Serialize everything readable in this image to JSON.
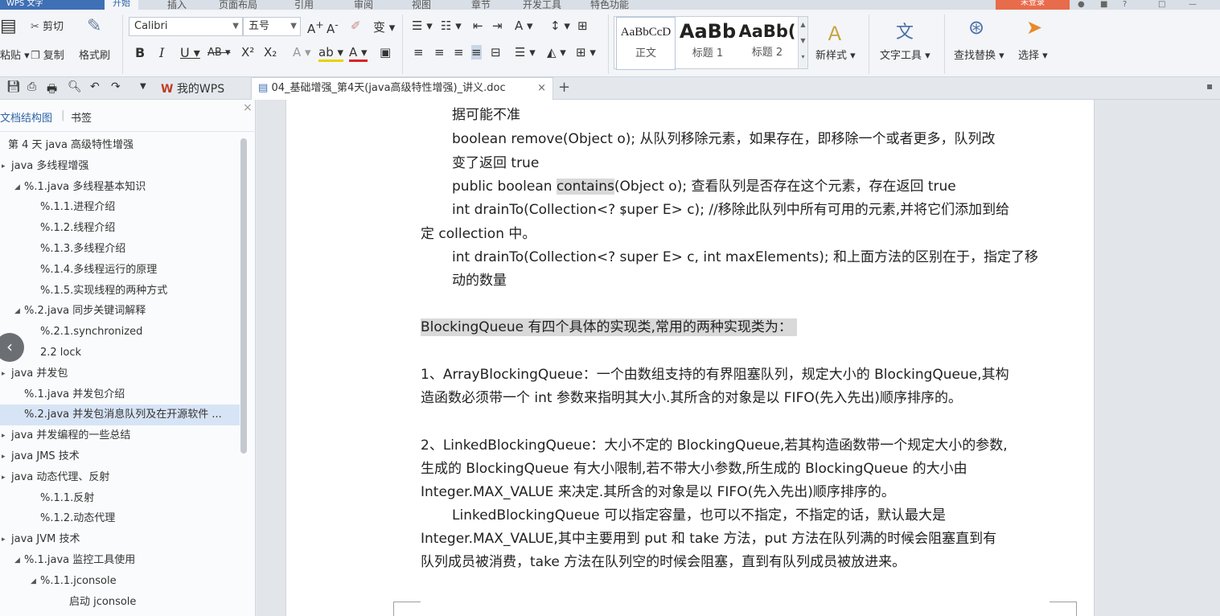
{
  "menubar": {
    "brand": "WPS 文字",
    "items": [
      "开始",
      "插入",
      "页面布局",
      "引用",
      "审阅",
      "视图",
      "章节",
      "开发工具",
      "特色功能"
    ],
    "login": "未登录"
  },
  "ribbon": {
    "paste": "粘贴",
    "cut": "剪切",
    "copy": "复制",
    "format_painter": "格式刷",
    "font_name": "Calibri",
    "font_size": "五号",
    "styles": [
      {
        "sample": "AaBbCcD",
        "label": "正文"
      },
      {
        "sample": "AaBb",
        "label": "标题 1"
      },
      {
        "sample": "AaBb(",
        "label": "标题 2"
      }
    ],
    "new_style": "新样式",
    "text_tools": "文字工具",
    "find_replace": "查找替换",
    "select": "选择"
  },
  "quickbar": {
    "my_wps": "我的WPS",
    "doc_tab_title": "04_基础增强_第4天(java高级特性增强)_讲义.doc"
  },
  "nav": {
    "tab_outline": "文档结构图",
    "tab_bookmark": "书签",
    "items": [
      {
        "text": "第 4 天 java 高级特性增强",
        "indent": 10,
        "arrow": ""
      },
      {
        "text": "java 多线程增强",
        "indent": 14,
        "arrow": "▸"
      },
      {
        "text": "%.1.java 多线程基本知识",
        "indent": 30,
        "arrow": "◢"
      },
      {
        "text": "%.1.1.进程介绍",
        "indent": 50,
        "arrow": ""
      },
      {
        "text": "%.1.2.线程介绍",
        "indent": 50,
        "arrow": ""
      },
      {
        "text": "%.1.3.多线程介绍",
        "indent": 50,
        "arrow": ""
      },
      {
        "text": "%.1.4.多线程运行的原理",
        "indent": 50,
        "arrow": ""
      },
      {
        "text": "%.1.5.实现线程的两种方式",
        "indent": 50,
        "arrow": ""
      },
      {
        "text": "%.2.java 同步关键词解释",
        "indent": 30,
        "arrow": "◢"
      },
      {
        "text": "%.2.1.synchronized",
        "indent": 50,
        "arrow": ""
      },
      {
        "text": "2.2 lock",
        "indent": 50,
        "arrow": ""
      },
      {
        "text": "java 并发包",
        "indent": 14,
        "arrow": "▸"
      },
      {
        "text": "%.1.java 并发包介绍",
        "indent": 30,
        "arrow": ""
      },
      {
        "text": "%.2.java 并发包消息队列及在开源软件 ...",
        "indent": 30,
        "arrow": "",
        "selected": true
      },
      {
        "text": "java 并发编程的一些总结",
        "indent": 14,
        "arrow": "▸"
      },
      {
        "text": "java JMS 技术",
        "indent": 14,
        "arrow": "▸"
      },
      {
        "text": "java 动态代理、反射",
        "indent": 14,
        "arrow": "▸"
      },
      {
        "text": "%.1.1.反射",
        "indent": 50,
        "arrow": ""
      },
      {
        "text": "%.1.2.动态代理",
        "indent": 50,
        "arrow": ""
      },
      {
        "text": "java JVM 技术",
        "indent": 14,
        "arrow": "▸"
      },
      {
        "text": "%.1.java 监控工具使用",
        "indent": 30,
        "arrow": "◢"
      },
      {
        "text": "%.1.1.jconsole",
        "indent": 50,
        "arrow": "◢"
      },
      {
        "text": "启动 jconsole",
        "indent": 86,
        "arrow": ""
      }
    ]
  },
  "doc": {
    "l1": "据可能不准",
    "l2": "boolean remove(Object o); 从队列移除元素，如果存在，即移除一个或者更多，队列改",
    "l3": "变了返回 true",
    "l4a": "public boolean ",
    "l4b": "contains",
    "l4c": "(Object o); 查看队列是否存在这个元素，存在返回 true",
    "l5": "int drainTo(Collection<? super E> c); //移除此队列中所有可用的元素,并将它们添加到给",
    "l6": "定 collection 中。",
    "l7": "int drainTo(Collection<? super E> c, int maxElements); 和上面方法的区别在于，指定了移",
    "l8": "动的数量",
    "l9": "BlockingQueue 有四个具体的实现类,常用的两种实现类为：",
    "l10": "1、ArrayBlockingQueue：一个由数组支持的有界阻塞队列，规定大小的 BlockingQueue,其构",
    "l11": "造函数必须带一个 int 参数来指明其大小.其所含的对象是以 FIFO(先入先出)顺序排序的。",
    "l12": "2、LinkedBlockingQueue：大小不定的 BlockingQueue,若其构造函数带一个规定大小的参数,",
    "l13": "生成的 BlockingQueue 有大小限制,若不带大小参数,所生成的 BlockingQueue 的大小由",
    "l14": "Integer.MAX_VALUE 来决定.其所含的对象是以 FIFO(先入先出)顺序排序的。",
    "l15": "LinkedBlockingQueue 可以指定容量，也可以不指定，不指定的话，默认最大是",
    "l16": "Integer.MAX_VALUE,其中主要用到 put 和 take 方法，put 方法在队列满的时候会阻塞直到有",
    "l17": "队列成员被消费，take 方法在队列空的时候会阻塞，直到有队列成员被放进来。"
  }
}
